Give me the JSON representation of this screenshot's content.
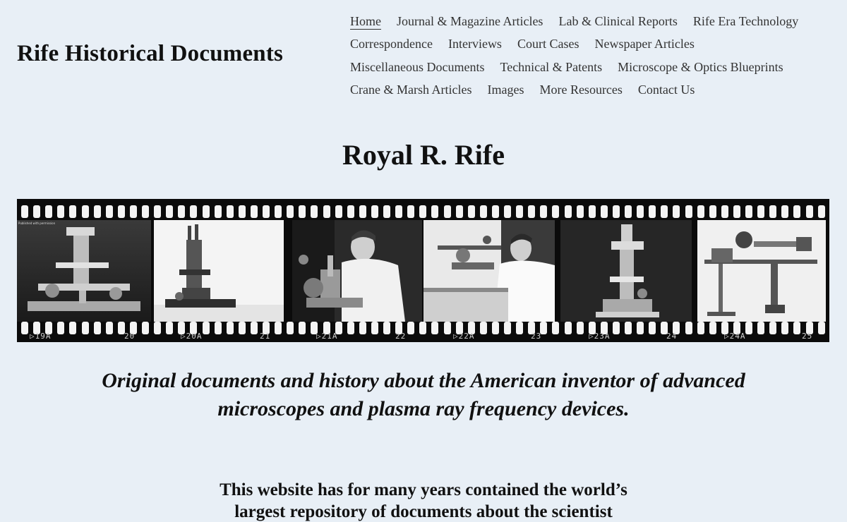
{
  "site": {
    "title": "Rife Historical Documents"
  },
  "nav": {
    "rows": [
      [
        "Home",
        "Journal & Magazine Articles",
        "Lab & Clinical Reports",
        "Rife Era Technology"
      ],
      [
        "Correspondence",
        "Interviews",
        "Court Cases",
        "Newspaper Articles"
      ],
      [
        "Miscellaneous Documents",
        "Technical & Patents",
        "Microscope & Optics Blueprints"
      ],
      [
        "Crane & Marsh Articles",
        "Images",
        "More Resources",
        "Contact Us"
      ]
    ],
    "current": "Home"
  },
  "page": {
    "title": "Royal R. Rife",
    "tagline_line1": "Original documents and history about the American inventor of advanced",
    "tagline_line2": "microscopes and plasma ray frequency devices.",
    "intro_line1": "This website has for many years contained the world’s",
    "intro_line2": "largest repository of documents about the scientist"
  },
  "filmstrip": {
    "edge_labels": [
      "▷19A",
      "20",
      "▷20A",
      "21",
      "▷21A",
      "22",
      "▷22A",
      "23",
      "▷23A",
      "24",
      "▷24A",
      "25"
    ],
    "frame_note": "Published with permission",
    "frames": [
      {
        "subject": "microscope on stand"
      },
      {
        "subject": "universal microscope"
      },
      {
        "subject": "scientist at microscope"
      },
      {
        "subject": "scientist at workbench"
      },
      {
        "subject": "tall microscope"
      },
      {
        "subject": "optical apparatus blueprint"
      }
    ]
  },
  "colors": {
    "background": "#e8eff6",
    "film": "#0b0b0b",
    "text": "#111111",
    "nav_text": "#333333"
  }
}
